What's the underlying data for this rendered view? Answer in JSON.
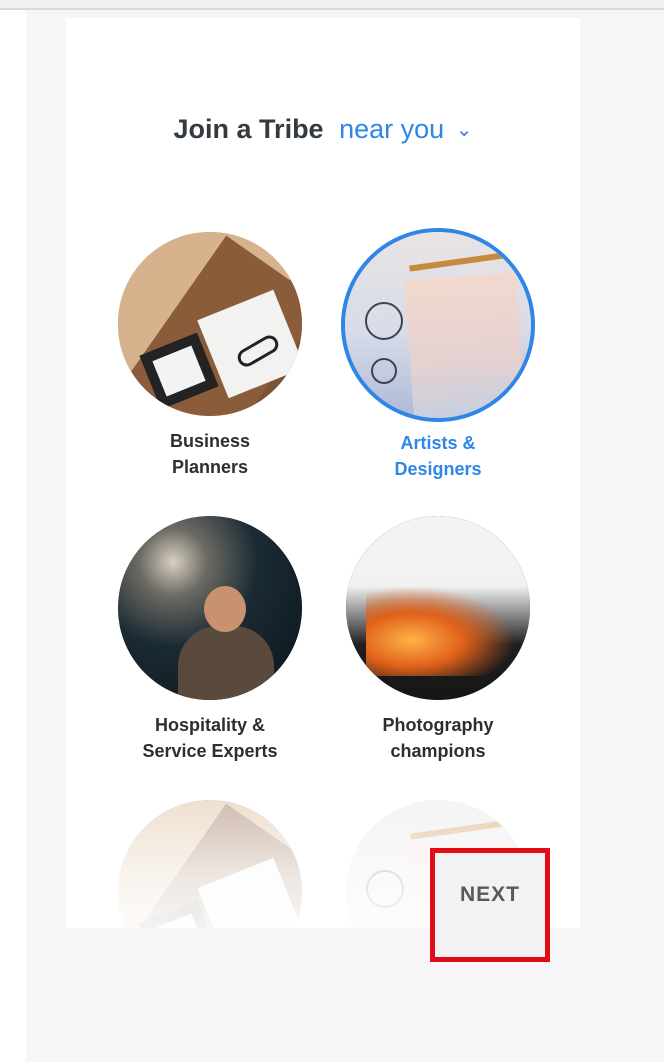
{
  "header": {
    "title": "Join a Tribe",
    "location_selector": "near you",
    "chevron_icon": "chevron-down-icon"
  },
  "tribes": [
    {
      "label_line1": "Business",
      "label_line2": "Planners",
      "selected": false
    },
    {
      "label_line1": "Artists &",
      "label_line2": "Designers",
      "selected": true
    },
    {
      "label_line1": "Hospitality &",
      "label_line2": "Service Experts",
      "selected": false
    },
    {
      "label_line1": "Photography",
      "label_line2": "champions",
      "selected": false
    }
  ],
  "footer": {
    "next_label": "NEXT"
  },
  "colors": {
    "accent": "#2f86e6",
    "text": "#2b2f33",
    "highlight_border": "#e00d16"
  }
}
